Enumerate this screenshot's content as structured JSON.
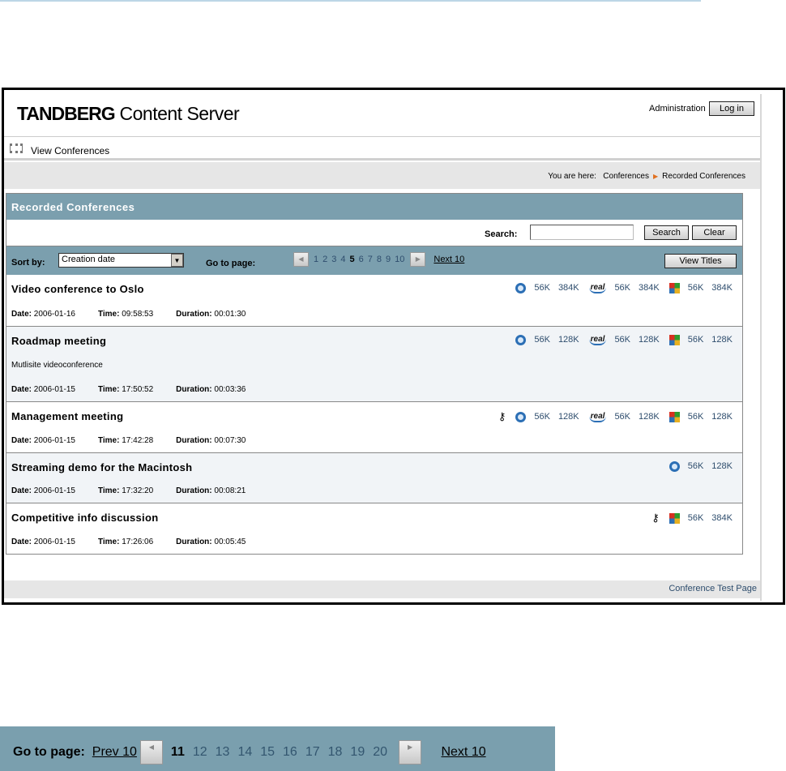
{
  "header": {
    "logo_bold": "TANDBERG",
    "logo_rest": " Content Server",
    "administration": "Administration",
    "login": "Log in"
  },
  "nav": {
    "view_conferences": "View Conferences"
  },
  "breadcrumb": {
    "prefix": "You are here:",
    "items": [
      "Conferences",
      "Recorded Conferences"
    ]
  },
  "panel": {
    "title": "Recorded Conferences",
    "search_label": "Search:",
    "search_value": "",
    "search_button": "Search",
    "clear_button": "Clear",
    "sort_label": "Sort by:",
    "sort_value": "Creation date",
    "goto_label": "Go to page:",
    "pages": [
      "1",
      "2",
      "3",
      "4",
      "5",
      "6",
      "7",
      "8",
      "9",
      "10"
    ],
    "current_page": "5",
    "next10": "Next 10",
    "view_titles": "View Titles"
  },
  "labels": {
    "date": "Date:",
    "time": "Time:",
    "duration": "Duration:"
  },
  "conferences": [
    {
      "title": "Video conference to Oslo",
      "desc": "",
      "date": "2006-01-16",
      "time": "09:58:53",
      "duration": "00:01:30",
      "key": false,
      "qt": [
        "56K",
        "384K"
      ],
      "real": [
        "56K",
        "384K"
      ],
      "wm": [
        "56K",
        "384K"
      ]
    },
    {
      "title": "Roadmap meeting",
      "desc": "Mutlisite videoconference",
      "date": "2006-01-15",
      "time": "17:50:52",
      "duration": "00:03:36",
      "key": false,
      "qt": [
        "56K",
        "128K"
      ],
      "real": [
        "56K",
        "128K"
      ],
      "wm": [
        "56K",
        "128K"
      ]
    },
    {
      "title": "Management meeting",
      "desc": "",
      "date": "2006-01-15",
      "time": "17:42:28",
      "duration": "00:07:30",
      "key": true,
      "qt": [
        "56K",
        "128K"
      ],
      "real": [
        "56K",
        "128K"
      ],
      "wm": [
        "56K",
        "128K"
      ]
    },
    {
      "title": "Streaming demo for the Macintosh",
      "desc": "",
      "date": "2006-01-15",
      "time": "17:32:20",
      "duration": "00:08:21",
      "key": false,
      "qt": [
        "56K",
        "128K"
      ],
      "real": [],
      "wm": []
    },
    {
      "title": "Competitive info discussion",
      "desc": "",
      "date": "2006-01-15",
      "time": "17:26:06",
      "duration": "00:05:45",
      "key": true,
      "qt": [],
      "real": [],
      "wm": [
        "56K",
        "384K"
      ]
    }
  ],
  "footer": {
    "test_page": "Conference Test Page"
  },
  "bottom_pager": {
    "label": "Go to page:",
    "prev10": "Prev 10",
    "pages": [
      "11",
      "12",
      "13",
      "14",
      "15",
      "16",
      "17",
      "18",
      "19",
      "20"
    ],
    "current_page": "11",
    "next10": "Next 10"
  }
}
